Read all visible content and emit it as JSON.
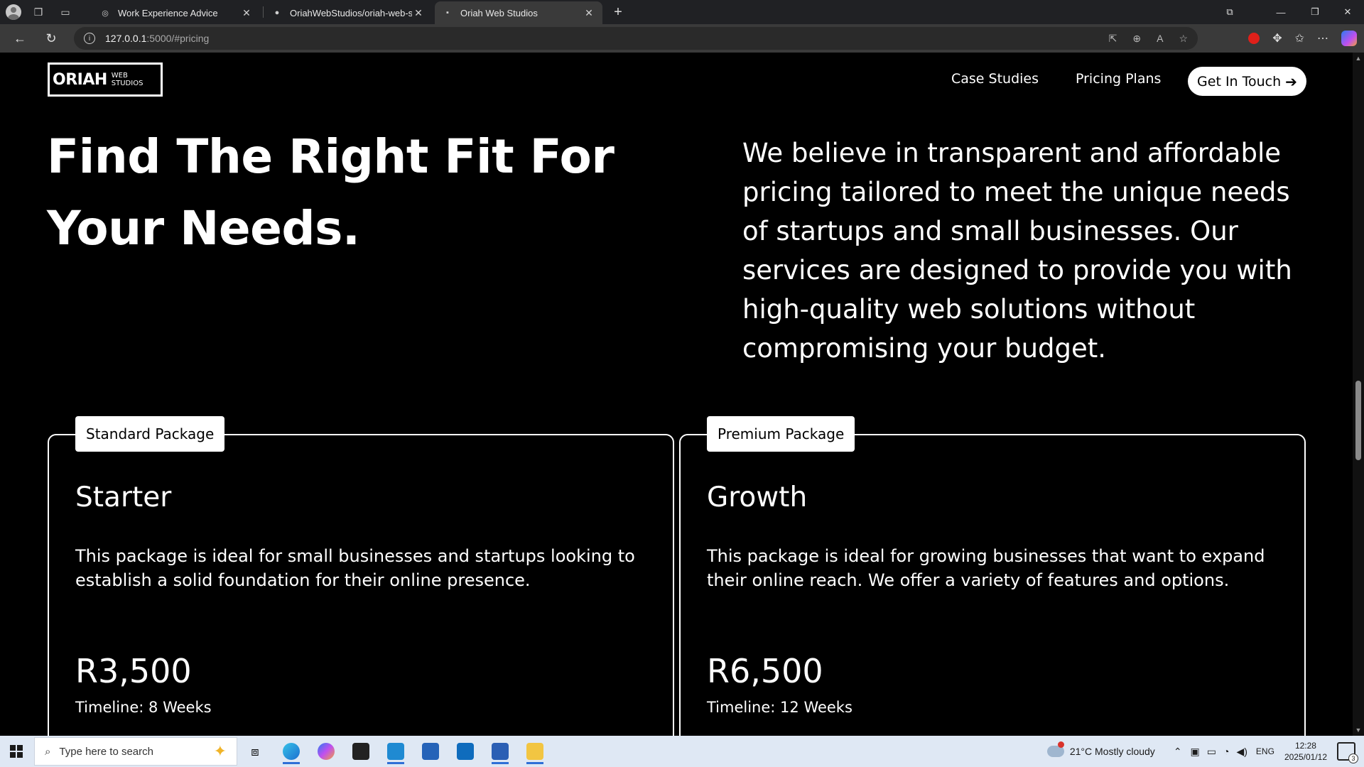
{
  "browser": {
    "tabs": [
      {
        "title": "Work Experience Advice",
        "icon": "globe-icon"
      },
      {
        "title": "OriahWebStudios/oriah-web-studi",
        "icon": "github-icon"
      },
      {
        "title": "Oriah Web Studios",
        "icon": "site-favicon"
      }
    ],
    "address": {
      "host": "127.0.0.1",
      "path": ":5000/#pricing"
    }
  },
  "site": {
    "logo": {
      "big": "ORIAH",
      "small": "WEB STUDIOS"
    },
    "nav": {
      "case_studies": "Case Studies",
      "pricing_plans": "Pricing Plans",
      "cta": "Get In Touch"
    },
    "hero": {
      "title": "Find The Right Fit For Your Needs.",
      "text": "We believe in transparent and affordable pricing tailored to meet the unique needs of startups and small businesses. Our services are designed to provide you with high-quality web solutions without compromising your budget."
    },
    "packages": [
      {
        "tag": "Standard Package",
        "name": "Starter",
        "description": "This package is ideal for small businesses and startups looking to establish a solid foundation for their online presence.",
        "price": "R3,500",
        "timeline": "Timeline: 8 Weeks"
      },
      {
        "tag": "Premium Package",
        "name": "Growth",
        "description": "This package is ideal for growing businesses that want to expand their online reach. We offer a variety of features and options.",
        "price": "R6,500",
        "timeline": "Timeline: 12 Weeks"
      }
    ]
  },
  "taskbar": {
    "search_placeholder": "Type here to search",
    "weather": "21°C  Mostly cloudy",
    "language": "ENG",
    "time": "12:28",
    "date": "2025/01/12",
    "notifications": "3",
    "weather_badge": "1"
  }
}
